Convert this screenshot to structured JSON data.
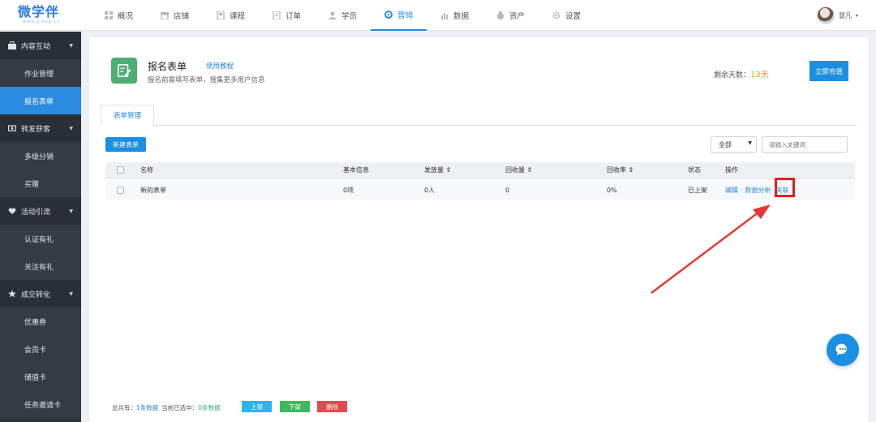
{
  "logo": {
    "text": "微学伴",
    "subtext": "www.xiaoe.cn"
  },
  "nav": [
    {
      "label": "概况",
      "icon": "grid-icon"
    },
    {
      "label": "店铺",
      "icon": "store-icon"
    },
    {
      "label": "课程",
      "icon": "course-icon"
    },
    {
      "label": "订单",
      "icon": "order-icon"
    },
    {
      "label": "学员",
      "icon": "user-icon"
    },
    {
      "label": "营销",
      "icon": "marketing-icon",
      "active": true
    },
    {
      "label": "数据",
      "icon": "chart-icon"
    },
    {
      "label": "资产",
      "icon": "money-icon"
    },
    {
      "label": "设置",
      "icon": "gear-icon"
    }
  ],
  "user": {
    "name": "慧凡"
  },
  "sidebar": {
    "groups": [
      {
        "label": "内容互动",
        "icon": "briefcase-icon",
        "items": [
          "作业管理",
          "报名表单"
        ]
      },
      {
        "label": "转发获客",
        "icon": "share-icon",
        "items": [
          "多级分销",
          "买赠"
        ]
      },
      {
        "label": "活动引流",
        "icon": "heart-icon",
        "items": [
          "认证有礼",
          "关注有礼"
        ]
      },
      {
        "label": "成交转化",
        "icon": "star-icon",
        "items": [
          "优惠券",
          "会员卡",
          "储值卡",
          "任务邀请卡"
        ]
      }
    ],
    "active_item": "报名表单"
  },
  "header": {
    "title": "报名表单",
    "tutorial_link": "使用教程",
    "description": "报名前需填写表单，搜集更多用户信息",
    "remaining_label": "剩余天数：",
    "remaining_days": "13天",
    "recharge_button": "立即充值"
  },
  "tabs": [
    {
      "label": "表单管理",
      "active": true
    }
  ],
  "toolbar": {
    "new_button": "新建表单",
    "filter_value": "全部",
    "search_placeholder": "请输入关键词"
  },
  "table": {
    "columns": [
      "名称",
      "基本信息",
      "发放量 ⇕",
      "回收量 ⇕",
      "回收率 ⇕",
      "状态",
      "操作"
    ],
    "rows": [
      {
        "name": "新的表单",
        "basic_info": "0项",
        "issued": "0人",
        "collected": "0",
        "rate": "0%",
        "status": "已上架",
        "actions": {
          "edit": "编辑",
          "analysis": "数据分析",
          "related": "关联"
        }
      }
    ]
  },
  "footer": {
    "total_prefix": "总共有：",
    "total_count": "1条数据",
    "selected_prefix": "当前已选中：",
    "selected_count": "0条数据",
    "btn_up": "上架",
    "btn_down": "下架",
    "btn_delete": "删除"
  },
  "colors": {
    "accent": "#2a8be0",
    "highlight": "#e02020",
    "sidebar": "#30343d"
  }
}
